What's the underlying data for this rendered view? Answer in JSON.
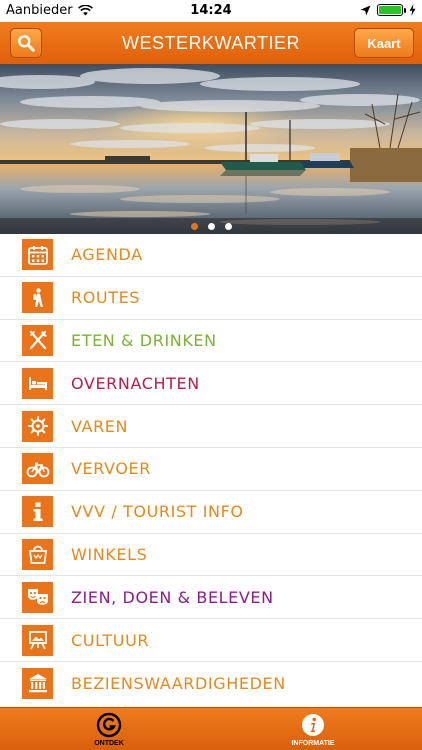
{
  "status_bar": {
    "carrier": "Aanbieder",
    "time": "14:24",
    "battery_level": 1.0
  },
  "header": {
    "title": "WESTERKWARTIER",
    "map_button": "Kaart",
    "search_icon": "search-icon"
  },
  "hero": {
    "slides": 3,
    "active_slide": 1
  },
  "menu": {
    "items": [
      {
        "label": "AGENDA",
        "color": "#e38a1d",
        "icon": "calendar-icon"
      },
      {
        "label": "ROUTES",
        "color": "#e38a1d",
        "icon": "hiker-icon"
      },
      {
        "label": "ETEN & DRINKEN",
        "color": "#7fb036",
        "icon": "fork-knife-icon"
      },
      {
        "label": "OVERNACHTEN",
        "color": "#b61f47",
        "icon": "bed-icon"
      },
      {
        "label": "VAREN",
        "color": "#e38a1d",
        "icon": "ship-wheel-icon"
      },
      {
        "label": "VERVOER",
        "color": "#e38a1d",
        "icon": "bicycle-icon"
      },
      {
        "label": "VVV / TOURIST INFO",
        "color": "#e38a1d",
        "icon": "info-icon"
      },
      {
        "label": "WINKELS",
        "color": "#e38a1d",
        "icon": "shopping-bag-icon"
      },
      {
        "label": "ZIEN, DOEN & BELEVEN",
        "color": "#8b1c8c",
        "icon": "theater-masks-icon"
      },
      {
        "label": "CULTUUR",
        "color": "#e38a1d",
        "icon": "easel-icon"
      },
      {
        "label": "BEZIENSWAARDIGHEDEN",
        "color": "#e38a1d",
        "icon": "museum-icon"
      }
    ]
  },
  "tabs": {
    "ontdek": {
      "label": "ONTDEK",
      "icon": "g-logo-icon",
      "color": "#000000"
    },
    "informatie": {
      "label": "INFORMATIE",
      "icon": "info-circle-icon",
      "color": "#ffffff"
    }
  }
}
